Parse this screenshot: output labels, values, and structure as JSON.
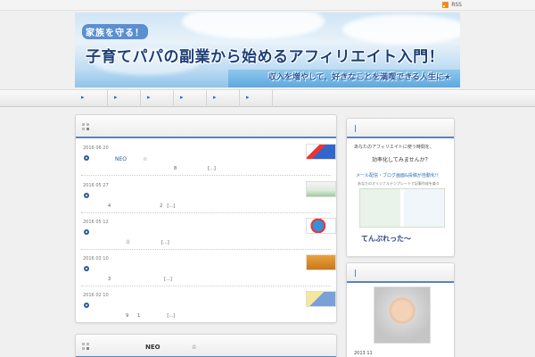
{
  "topbar": {
    "rss_label": "RSS"
  },
  "banner": {
    "tagline": "家族を守る！",
    "title": "子育てパパの副業から始めるアフィリエイト入門！",
    "subtitle": "収入を増やして、好きなことを満喫できる人生に★"
  },
  "nav": {
    "items": [
      "",
      "",
      "",
      "",
      "",
      ""
    ]
  },
  "entries": [
    {
      "date": "2016 06 20",
      "title": "NEO　　　☆",
      "excerpt": "8　　　　　　　[...]"
    },
    {
      "date": "2016 05 27",
      "title": "",
      "excerpt": "4　　　　　　　　　　　2　[...]"
    },
    {
      "date": "2016 05 12",
      "title": "",
      "excerpt": "　　　　（）　　　　　　　[...]"
    },
    {
      "date": "2016 03 10",
      "title": "",
      "excerpt": "3　　　　　　　　　　　　[...]"
    },
    {
      "date": "2016 02 10",
      "title": "",
      "excerpt": "　　　　9　　1　　　　　　[...]"
    }
  ],
  "bottom_panel": {
    "title": "NEO　　　　　☆"
  },
  "ad_widget": {
    "line1": "あなたのアフィリエイトに使う時間を、",
    "line2": "効率化してみませんか？",
    "line3": "メール配信・ブログ画面&投稿が自動化!!",
    "line4": "あなたのオリジナルテンプレートで記事作成を楽々",
    "logo_text": "てんぷれった〜"
  },
  "profile_widget": {
    "date": "2013 11"
  },
  "colors": {
    "accent": "#2a5d9c",
    "rss": "#f08c1a",
    "nav_arrow": "#2a6fb8"
  }
}
